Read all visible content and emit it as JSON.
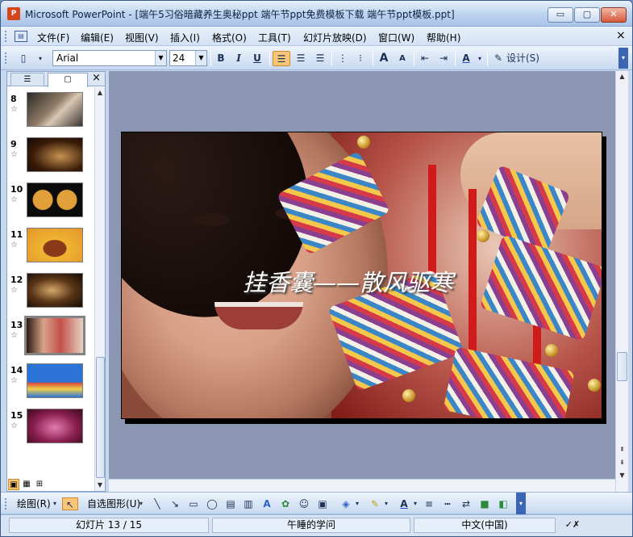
{
  "window": {
    "app_icon": "P",
    "title": "Microsoft PowerPoint - [端午5习俗暗藏养生奥秘ppt 端午节ppt免费模板下载  端午节ppt模板.ppt]",
    "minimize": "▭",
    "maximize": "▢",
    "close": "✕"
  },
  "menu": {
    "items": [
      "文件(F)",
      "编辑(E)",
      "视图(V)",
      "插入(I)",
      "格式(O)",
      "工具(T)",
      "幻灯片放映(D)",
      "窗口(W)",
      "帮助(H)"
    ],
    "doc_close": "×"
  },
  "toolbar": {
    "font": "Arial",
    "font_size": "24",
    "bold": "B",
    "italic": "I",
    "underline": "U",
    "increase_font": "A",
    "decrease_font": "A",
    "font_color": "A",
    "design_label": "设计(S)"
  },
  "slides_panel": {
    "tab_outline": "☰",
    "tab_slides": "▢",
    "close": "×",
    "star": "☆",
    "thumbnails": [
      {
        "num": "8"
      },
      {
        "num": "9"
      },
      {
        "num": "10"
      },
      {
        "num": "11"
      },
      {
        "num": "12"
      },
      {
        "num": "13"
      },
      {
        "num": "14"
      },
      {
        "num": "15"
      }
    ],
    "selected": "13"
  },
  "slide": {
    "title": "挂香囊——散风驱寒"
  },
  "drawing_toolbar": {
    "draw_label": "绘图(R)",
    "autoshapes_label": "自选图形(U)"
  },
  "status": {
    "slide_indicator": "幻灯片 13 / 15",
    "design_template": "午睡的学问",
    "language": "中文(中国)"
  },
  "colors": {
    "accent_orange": "#f9c577",
    "titlebar_blue": "#bcd3ee",
    "canvas_bg": "#8b96b3"
  }
}
